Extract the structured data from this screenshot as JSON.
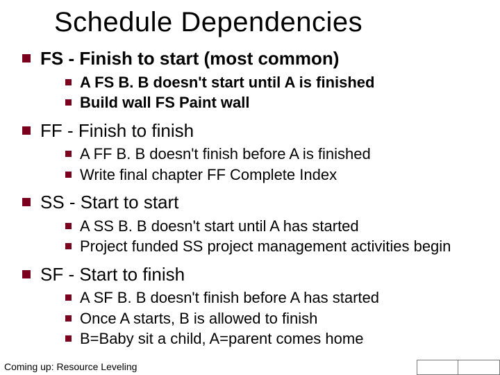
{
  "slide": {
    "title": "Schedule Dependencies",
    "items": [
      {
        "label": "FS - Finish to start (most common)",
        "bold": true,
        "subs": [
          {
            "text": "A FS B. B doesn't start until A is finished",
            "bold": true
          },
          {
            "text": "Build wall FS Paint wall",
            "bold": true
          }
        ]
      },
      {
        "label": "FF - Finish to finish",
        "bold": false,
        "subs": [
          {
            "text": "A FF B. B doesn't finish before A is finished",
            "bold": false
          },
          {
            "text": "Write final chapter FF Complete Index",
            "bold": false
          }
        ]
      },
      {
        "label": "SS - Start to start",
        "bold": false,
        "subs": [
          {
            "text": "A SS B. B doesn't start until A has started",
            "bold": false
          },
          {
            "text": "Project funded SS project management activities begin",
            "bold": false
          }
        ]
      },
      {
        "label": "SF - Start to finish",
        "bold": false,
        "subs": [
          {
            "text": "A SF B. B doesn't finish before A has started",
            "bold": false
          },
          {
            "text": "Once A starts, B is allowed to finish",
            "bold": false
          },
          {
            "text": "B=Baby sit a child, A=parent comes home",
            "bold": false
          }
        ]
      }
    ],
    "footer": "Coming up: Resource Leveling"
  }
}
